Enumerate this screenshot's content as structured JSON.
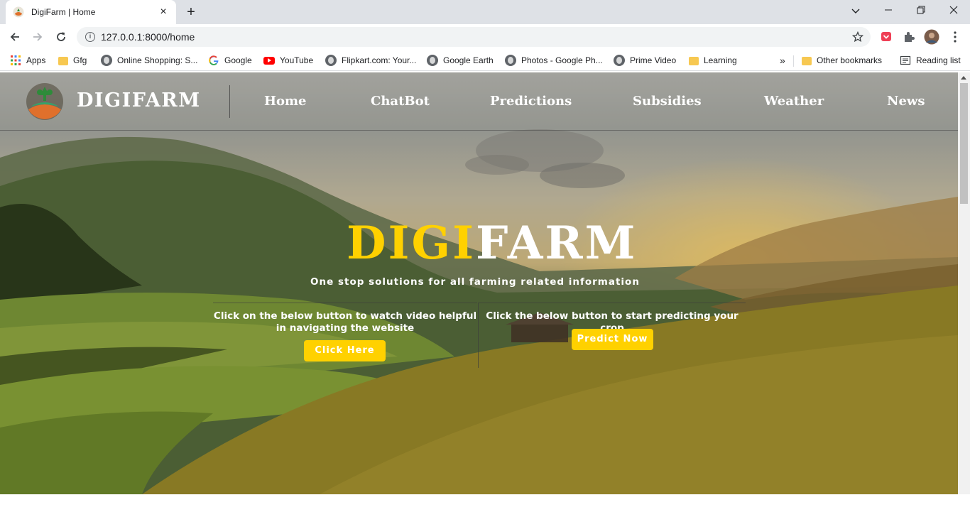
{
  "browser": {
    "tab_title": "DigiFarm | Home",
    "url": "127.0.0.1:8000/home",
    "bookmarks": [
      {
        "label": "Apps",
        "icon": "apps-grid-icon"
      },
      {
        "label": "Gfg",
        "icon": "folder-icon"
      },
      {
        "label": "Online Shopping: S...",
        "icon": "globe-icon"
      },
      {
        "label": "Google",
        "icon": "google-icon"
      },
      {
        "label": "YouTube",
        "icon": "youtube-icon"
      },
      {
        "label": "Flipkart.com: Your...",
        "icon": "globe-icon"
      },
      {
        "label": "Google Earth",
        "icon": "globe-icon"
      },
      {
        "label": "Photos - Google Ph...",
        "icon": "globe-icon"
      },
      {
        "label": "Prime Video",
        "icon": "globe-icon"
      },
      {
        "label": "Learning",
        "icon": "folder-icon"
      }
    ],
    "overflow_label": "»",
    "other_bookmarks": "Other bookmarks",
    "reading_list": "Reading list"
  },
  "site": {
    "logo_text": "DIGIFARM",
    "nav": [
      "Home",
      "ChatBot",
      "Predictions",
      "Subsidies",
      "Weather",
      "News"
    ],
    "hero": {
      "title_part1": "DIGI",
      "title_part2": "FARM",
      "subtitle": "One stop solutions for all farming related information",
      "left_text": "Click on the below button to watch video helpful in navigating the website",
      "left_button": "Click Here",
      "right_text": "Click the below button to start predicting your crop",
      "right_button": "Predict Now"
    },
    "colors": {
      "accent": "#ffd100",
      "text": "#ffffff"
    }
  }
}
